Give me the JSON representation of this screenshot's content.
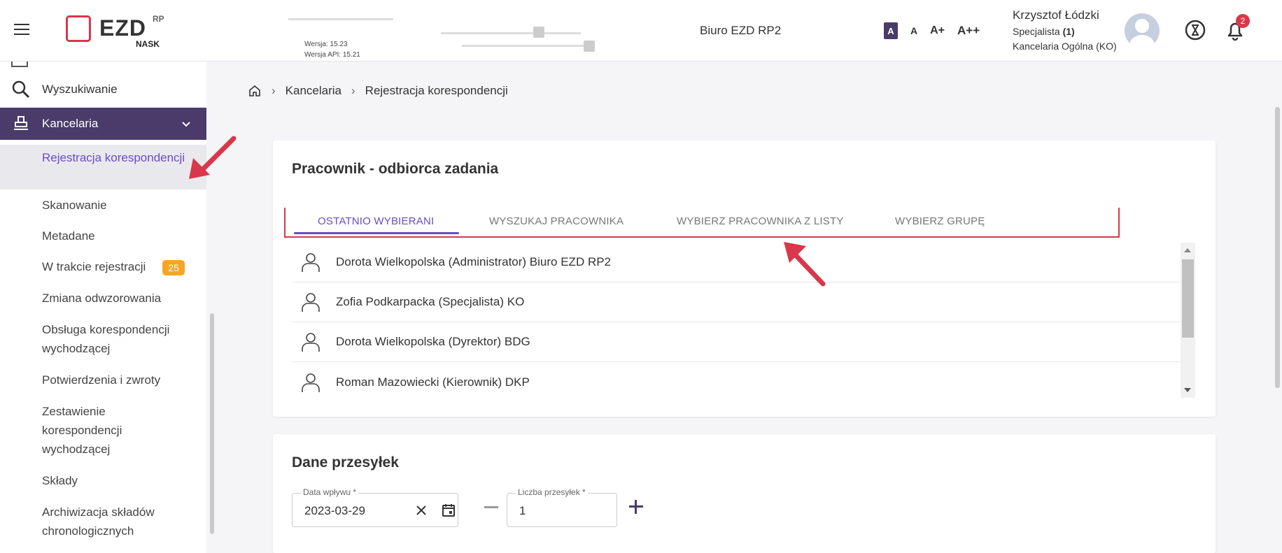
{
  "header": {
    "logo_text": "EZD",
    "logo_sup": "RP",
    "logo_sub": "NASK",
    "version": "Wersja: 15.23",
    "version_api": "Wersja API: 15.21",
    "office": "Biuro EZD RP2",
    "font_controls": [
      "A",
      "A",
      "A+",
      "A++"
    ],
    "user": {
      "name": "Krzysztof Łódzki",
      "role": "Specjalista",
      "role_count": "(1)",
      "unit": "Kancelaria Ogólna (KO)"
    },
    "notifications_count": "2"
  },
  "sidebar": {
    "search_label": "Wyszukiwanie",
    "kancelaria_label": "Kancelaria",
    "items": [
      {
        "label": "Rejestracja korespondencji",
        "active": true
      },
      {
        "label": "Skanowanie"
      },
      {
        "label": "Metadane"
      },
      {
        "label": "W trakcie rejestracji",
        "badge": "25"
      },
      {
        "label": "Zmiana odwzorowania"
      },
      {
        "label": "Obsługa korespondencji wychodzącej"
      },
      {
        "label": "Potwierdzenia i zwroty"
      },
      {
        "label": "Zestawienie korespondencji wychodzącej"
      },
      {
        "label": "Składy"
      },
      {
        "label": "Archiwizacja składów chronologicznych"
      }
    ]
  },
  "breadcrumb": {
    "level1": "Kancelaria",
    "level2": "Rejestracja korespondencji"
  },
  "recipient_card": {
    "title": "Pracownik - odbiorca zadania",
    "tabs": [
      "OSTATNIO WYBIERANI",
      "WYSZUKAJ PRACOWNIKA",
      "WYBIERZ PRACOWNIKA Z LISTY",
      "WYBIERZ GRUPĘ"
    ],
    "active_tab": 0,
    "people": [
      "Dorota Wielkopolska (Administrator) Biuro EZD RP2",
      "Zofia Podkarpacka (Specjalista) KO",
      "Dorota Wielkopolska (Dyrektor) BDG",
      "Roman Mazowiecki (Kierownik) DKP"
    ]
  },
  "shipment_card": {
    "title": "Dane przesyłek",
    "date_label": "Data wpływu *",
    "date_value": "2023-03-29",
    "count_label": "Liczba przesyłek *",
    "count_value": "1"
  },
  "colors": {
    "primary": "#4a3b6b",
    "accent": "#6a4cc8",
    "highlight": "#d9374b",
    "badge": "#f5a623"
  }
}
